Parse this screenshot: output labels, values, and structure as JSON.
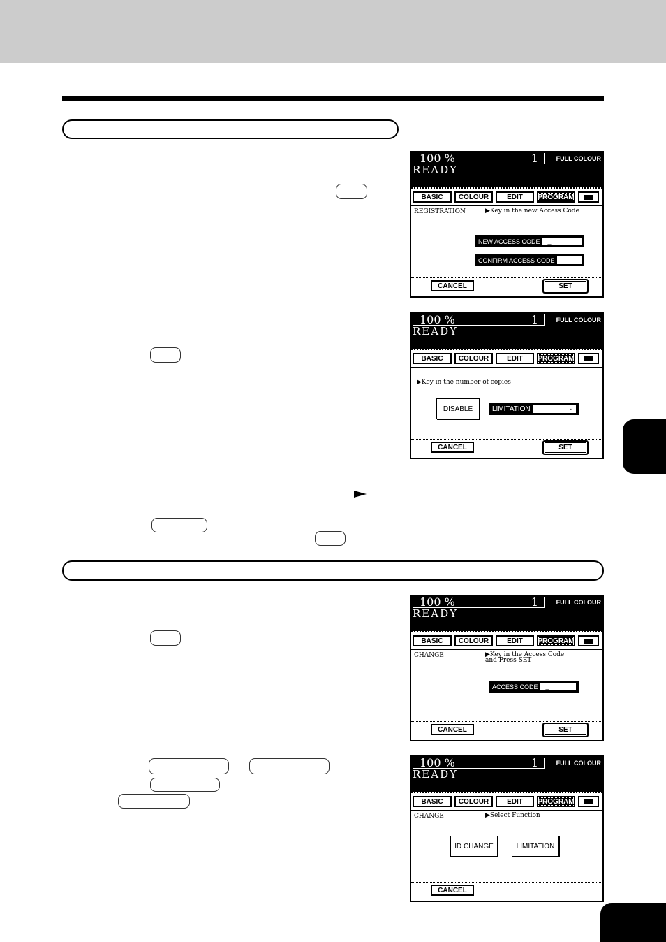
{
  "document": {
    "header_band_color": "#cccccc",
    "ink_color": "#000000"
  },
  "panels": [
    {
      "ratio": "100 %",
      "count": "1",
      "mode": "FULL COLOUR",
      "status": "READY",
      "tabs": [
        "BASIC",
        "COLOUR",
        "EDIT",
        "PROGRAM"
      ],
      "active_tab": "PROGRAM",
      "keyboard_icon": "keyboard-icon",
      "label": "REGISTRATION",
      "message": "▶Key in the new Access Code",
      "fields": [
        {
          "label": "NEW ACCESS CODE",
          "value": "_"
        },
        {
          "label": "CONFIRM ACCESS CODE",
          "value": ""
        }
      ],
      "cancel": "CANCEL",
      "set": "SET"
    },
    {
      "ratio": "100 %",
      "count": "1",
      "mode": "FULL COLOUR",
      "status": "READY",
      "tabs": [
        "BASIC",
        "COLOUR",
        "EDIT",
        "PROGRAM"
      ],
      "active_tab": "PROGRAM",
      "message": "▶Key in the number of copies",
      "disable_button": "DISABLE",
      "fields": [
        {
          "label": "LIMITATION",
          "value": "-"
        }
      ],
      "cancel": "CANCEL",
      "set": "SET"
    },
    {
      "ratio": "100 %",
      "count": "1",
      "mode": "FULL COLOUR",
      "status": "READY",
      "tabs": [
        "BASIC",
        "COLOUR",
        "EDIT",
        "PROGRAM"
      ],
      "active_tab": "PROGRAM",
      "label": "CHANGE",
      "message_line1": "▶Key in the Access Code",
      "message_line2": "and Press SET",
      "fields": [
        {
          "label": "ACCESS CODE",
          "value": "_"
        }
      ],
      "cancel": "CANCEL",
      "set": "SET"
    },
    {
      "ratio": "100 %",
      "count": "1",
      "mode": "FULL COLOUR",
      "status": "READY",
      "tabs": [
        "BASIC",
        "COLOUR",
        "EDIT",
        "PROGRAM"
      ],
      "active_tab": "PROGRAM",
      "label": "CHANGE",
      "message": "▶Select Function",
      "function_buttons": [
        "ID CHANGE",
        "LIMITATION"
      ],
      "cancel": "CANCEL"
    }
  ]
}
